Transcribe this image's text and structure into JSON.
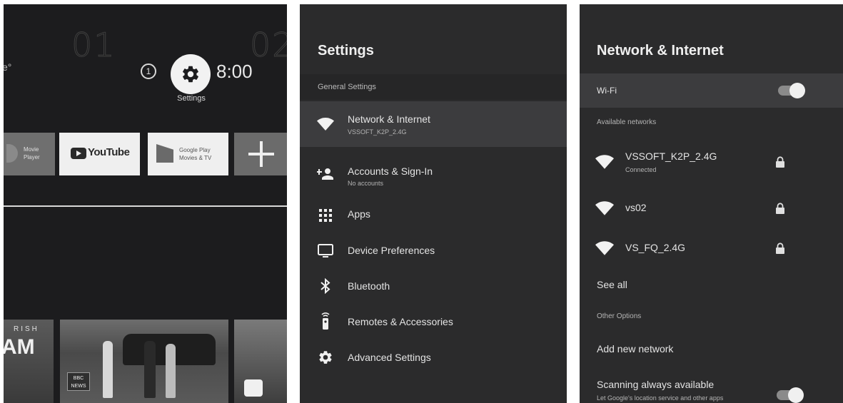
{
  "home": {
    "clock_left": "01",
    "clock_right": "02",
    "weather_fragment": "e°",
    "notification_count": "1",
    "time": "8:00",
    "settings_caption": "Settings",
    "apps": [
      {
        "name": "Movie Player",
        "line1": "Movie",
        "line2": "Player"
      },
      {
        "name": "YouTube",
        "label": "YouTube"
      },
      {
        "name": "Google Play Movies & TV",
        "line1": "Google Play",
        "line2": "Movies & TV"
      },
      {
        "name": "Add app",
        "icon": "plus-icon"
      }
    ],
    "row_fragment_left": "RISH",
    "row_fragment_big": "AM",
    "news_badge_line1": "BBC",
    "news_badge_line2": "NEWS"
  },
  "settings": {
    "title": "Settings",
    "section": "General Settings",
    "items": [
      {
        "label": "Network & Internet",
        "sub": "VSSOFT_K2P_2.4G",
        "icon": "wifi-icon",
        "selected": true
      },
      {
        "label": "Accounts & Sign-In",
        "sub": "No accounts",
        "icon": "add-person-icon"
      },
      {
        "label": "Apps",
        "icon": "apps-grid-icon"
      },
      {
        "label": "Device Preferences",
        "icon": "tv-icon"
      },
      {
        "label": "Bluetooth",
        "icon": "bluetooth-icon"
      },
      {
        "label": "Remotes & Accessories",
        "icon": "remote-icon"
      },
      {
        "label": "Advanced Settings",
        "icon": "gear-icon"
      }
    ]
  },
  "network": {
    "title": "Network & Internet",
    "wifi_label": "Wi-Fi",
    "wifi_on": true,
    "available_label": "Available networks",
    "networks": [
      {
        "name": "VSSOFT_K2P_2.4G",
        "status": "Connected",
        "locked": true
      },
      {
        "name": "vs02",
        "locked": true
      },
      {
        "name": "VS_FQ_2.4G",
        "locked": true
      }
    ],
    "see_all": "See all",
    "other_label": "Other Options",
    "add_network": "Add new network",
    "scanning_label": "Scanning always available",
    "scanning_sub": "Let Google's location service and other apps",
    "scanning_on": true
  },
  "colors": {
    "panel_bg": "#2b2b2c",
    "selected_row": "#3c3c3e",
    "home_bg": "#1c1c1e"
  }
}
